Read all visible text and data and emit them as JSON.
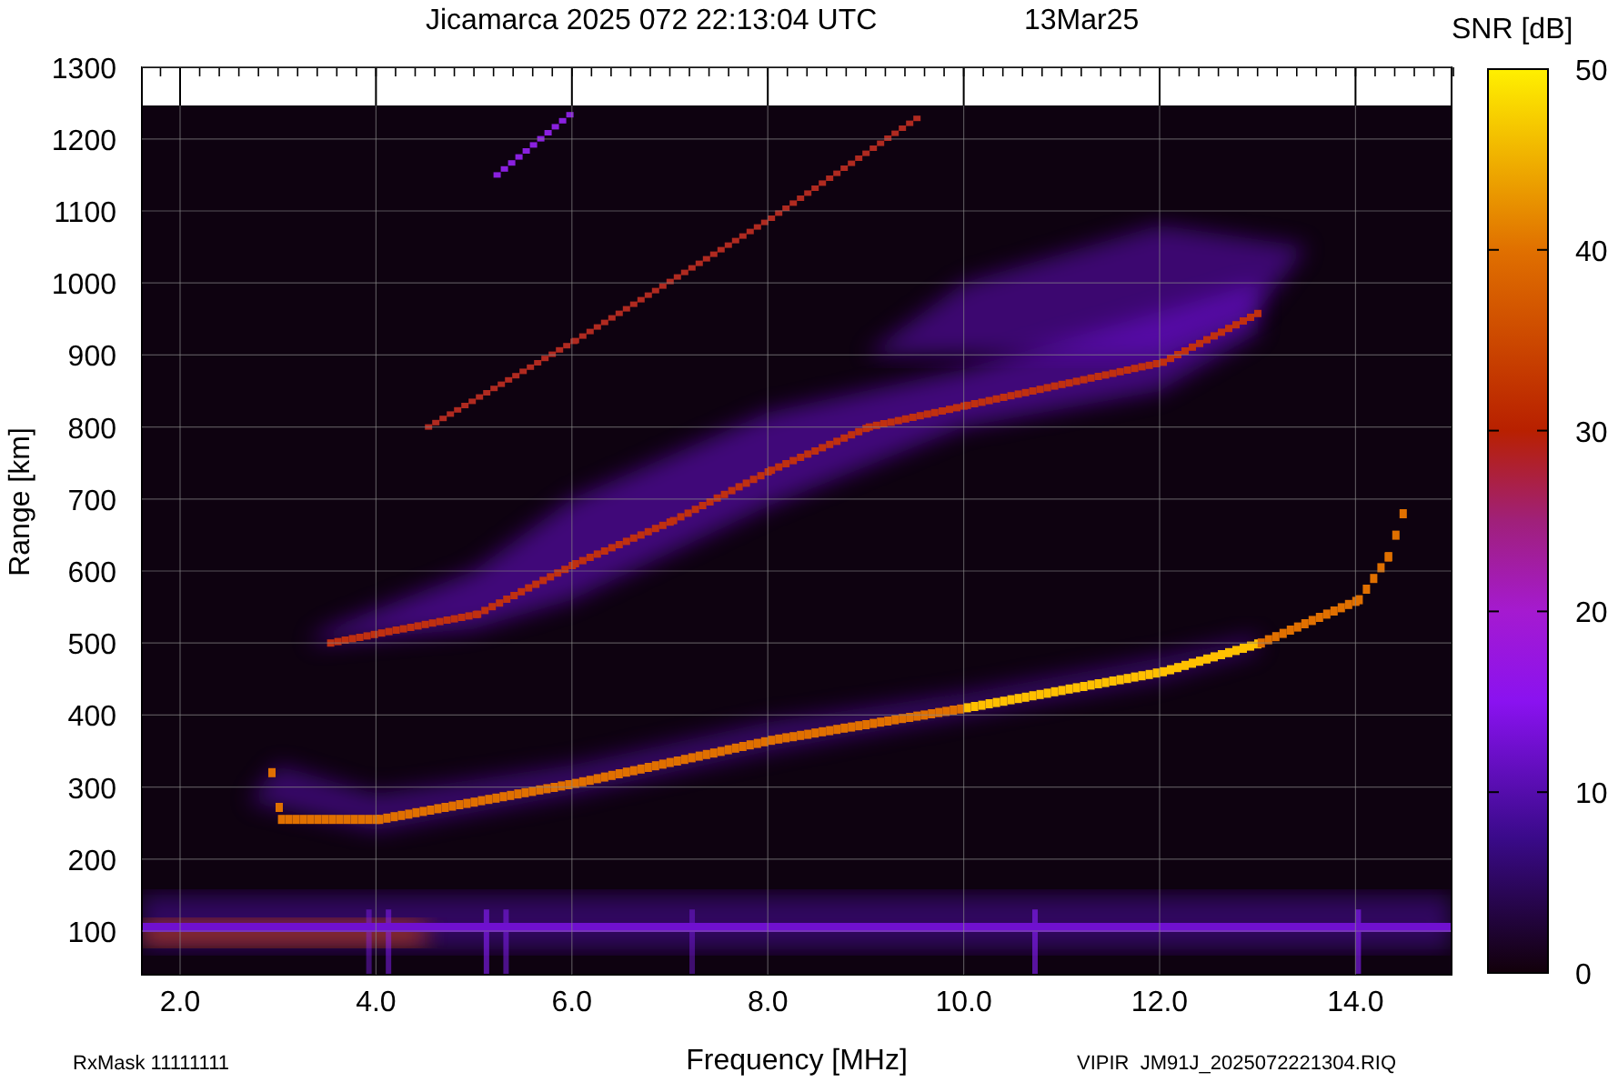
{
  "title": "Jicamarca 2025 072 22:13:04 UTC",
  "date": "13Mar25",
  "colorbar": {
    "label": "SNR [dB]",
    "ticks": [
      "50",
      "40",
      "30",
      "20",
      "10",
      "0"
    ]
  },
  "y_axis": {
    "label": "Range [km]",
    "ticks": [
      "1300",
      "1200",
      "1100",
      "1000",
      "900",
      "800",
      "700",
      "600",
      "500",
      "400",
      "300",
      "200",
      "100"
    ]
  },
  "x_axis": {
    "label": "Frequency [MHz]",
    "ticks": [
      "2.0",
      "4.0",
      "6.0",
      "8.0",
      "10.0",
      "12.0",
      "14.0"
    ]
  },
  "footer": {
    "left": "RxMask 11111111",
    "right": "VIPIR  JM91J_2025072221304.RIQ"
  }
}
